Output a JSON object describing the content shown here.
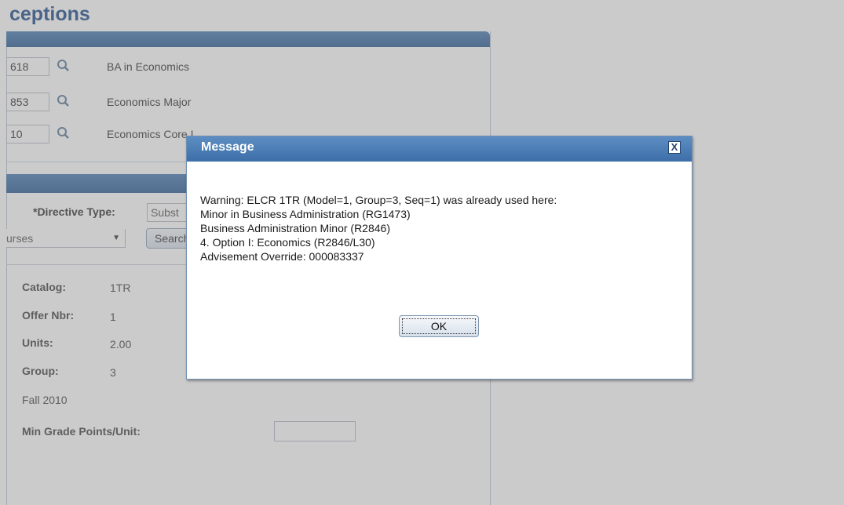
{
  "page": {
    "title": "ceptions"
  },
  "lookups": [
    {
      "code": "618",
      "description": "BA in Economics"
    },
    {
      "code": "853",
      "description": "Economics Major"
    },
    {
      "code": "10",
      "description": "Economics Core I"
    }
  ],
  "directive": {
    "label": "*Directive Type:",
    "value": "Subst",
    "courses_value": "urses",
    "search_label": "Search"
  },
  "details": {
    "catalog_label": "Catalog:",
    "catalog_value": "1TR",
    "offer_label": "Offer Nbr:",
    "offer_value": "1",
    "units_label": "Units:",
    "units_value": "2.00",
    "group_label": "Group:",
    "group_value": "3",
    "term": "Fall 2010",
    "min_grade_label": "Min Grade Points/Unit:",
    "min_grade_value": ""
  },
  "dialog": {
    "title": "Message",
    "lines": [
      "Warning:  ELCR 1TR (Model=1, Group=3, Seq=1) was already used here:",
      "Minor in Business Administration (RG1473)",
      "Business Administration Minor (R2846)",
      "4. Option I: Economics (R2846/L30)",
      "Advisement Override: 000083337"
    ],
    "ok_label": "OK",
    "close_glyph": "X"
  },
  "colors": {
    "title_blue": "#1f4e8c",
    "header_blue": "#3d6ea8"
  },
  "icons": {
    "lookup": "magnifier-icon",
    "close": "close-icon",
    "dropdown": "chevron-down-icon"
  }
}
